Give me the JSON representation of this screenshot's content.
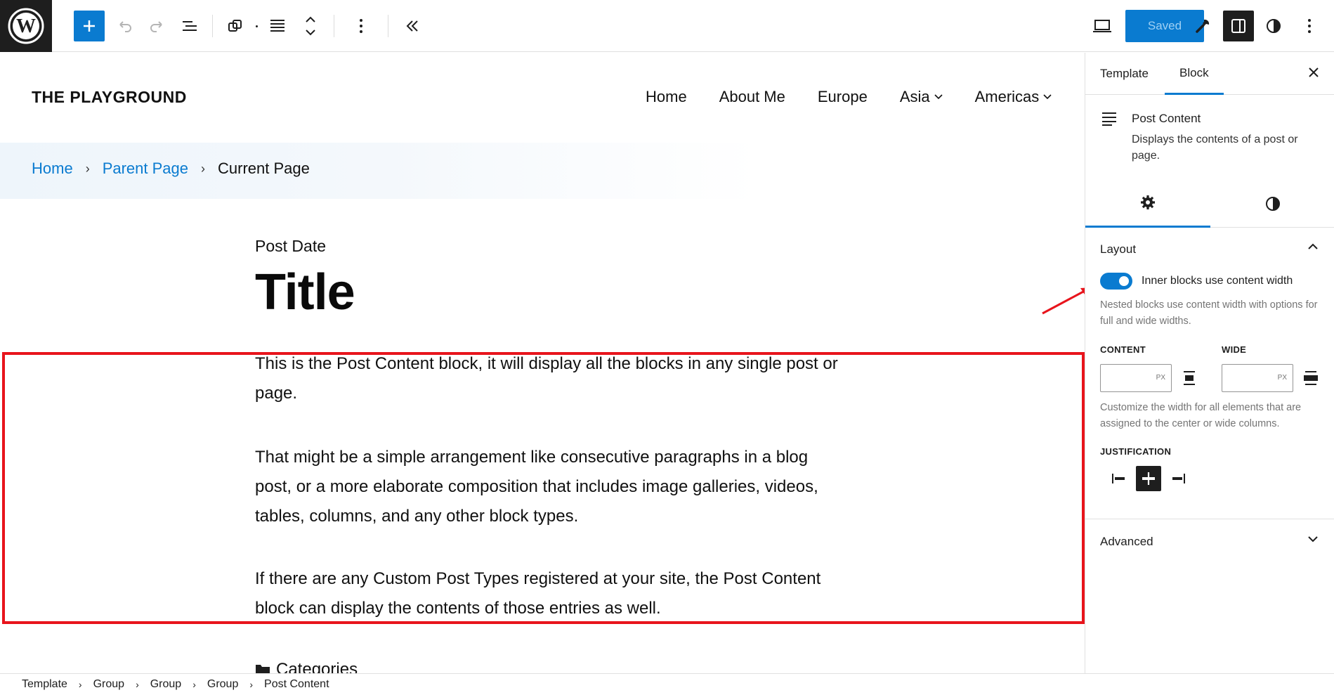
{
  "toolbar": {
    "saved_label": "Saved",
    "icons": [
      "wordpress-logo",
      "plus",
      "undo",
      "redo",
      "list-view",
      "duplicate",
      "align",
      "move-up-down",
      "more-vertical",
      "collapse",
      "desktop-view",
      "tools",
      "sidebar-toggle",
      "styles",
      "options"
    ],
    "accent_color": "#0a7bd0"
  },
  "canvas": {
    "site_title": "THE PLAYGROUND",
    "nav": [
      {
        "label": "Home"
      },
      {
        "label": "About Me"
      },
      {
        "label": "Europe"
      },
      {
        "label": "Asia"
      },
      {
        "label": "Americas"
      }
    ],
    "breadcrumbs": {
      "home": "Home",
      "parent": "Parent Page",
      "current": "Current Page",
      "separator": "›"
    },
    "post_date": "Post Date",
    "post_title": "Title",
    "paragraphs": [
      "This is the Post Content block, it will display all the blocks in any single post or page.",
      "That might be a simple arrangement like consecutive paragraphs in a blog post, or a more elaborate composition that includes image galleries, videos, tables, columns, and any other block types.",
      "If there are any Custom Post Types registered at your site, the Post Content block can display the contents of those entries as well."
    ],
    "categories_label": "Categories",
    "highlight_color": "#e8141c"
  },
  "sidebar": {
    "tabs": {
      "template": "Template",
      "block": "Block"
    },
    "block": {
      "name": "Post Content",
      "description": "Displays the contents of a post or page."
    },
    "layout": {
      "heading": "Layout",
      "toggle_label": "Inner blocks use content width",
      "toggle_on": true,
      "toggle_help": "Nested blocks use content width with options for full and wide widths.",
      "content_label": "CONTENT",
      "wide_label": "WIDE",
      "content_value": "",
      "wide_value": "",
      "unit": "PX",
      "width_help": "Customize the width for all elements that are assigned to the center or wide columns.",
      "justification_label": "JUSTIFICATION",
      "justification_selected": "center"
    },
    "advanced_heading": "Advanced"
  },
  "footer": {
    "crumbs": [
      "Template",
      "Group",
      "Group",
      "Group",
      "Post Content"
    ]
  }
}
